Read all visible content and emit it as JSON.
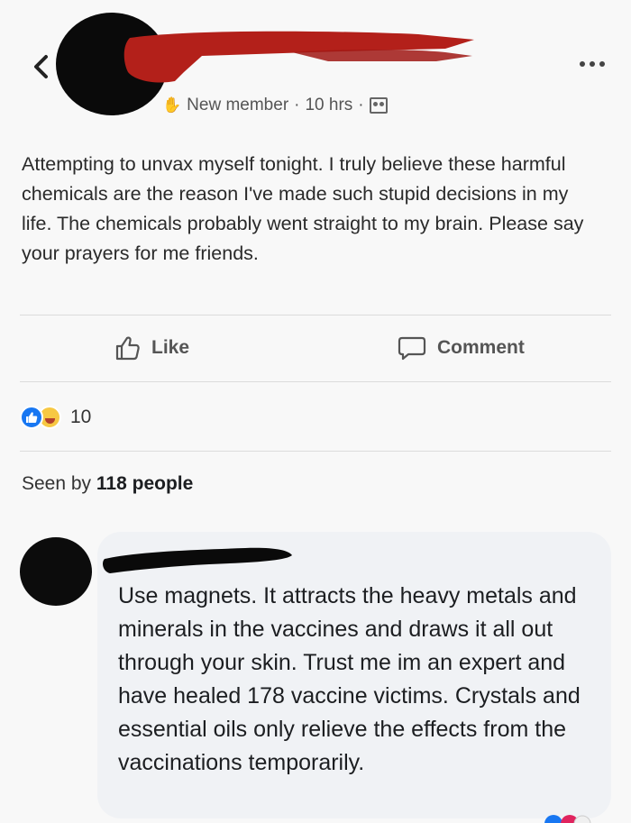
{
  "header": {
    "back_icon": "chevron-left-icon",
    "more_icon": "more-dots-icon",
    "badge_icon": "waving-hand-icon",
    "badge_label": "New member",
    "separator": "·",
    "time": "10 hrs",
    "audience_icon": "group-audience-icon"
  },
  "post": {
    "text": "Attempting to unvax myself tonight. I truly believe these harmful chemicals are the reason I've made such stupid decisions in my life. The chemicals probably went straight to my brain. Please say your prayers for me friends."
  },
  "actions": {
    "like_label": "Like",
    "comment_label": "Comment"
  },
  "reactions": {
    "types": [
      "like",
      "haha"
    ],
    "count": "10"
  },
  "seen": {
    "prefix": "Seen by",
    "value": "118 people"
  },
  "comment": {
    "text": "Use magnets. It attracts the heavy metals and minerals in the vaccines and draws it all out through your skin. Trust me im an expert and have healed 178 vaccine victims. Crystals and essential oils only relieve the effects from the vaccinations temporarily."
  },
  "colors": {
    "redaction_red": "#b3201a",
    "redaction_black": "#0a0a0a",
    "like_blue": "#1877f2",
    "bubble_bg": "#f0f2f5"
  }
}
